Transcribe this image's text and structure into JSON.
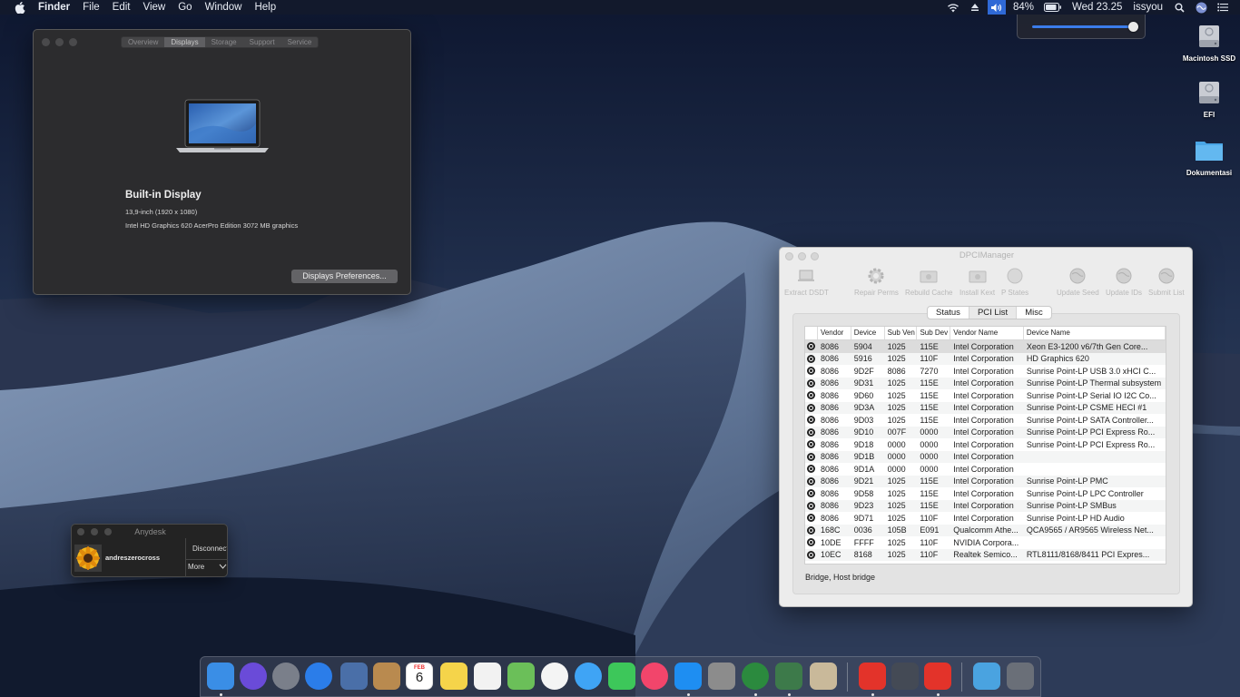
{
  "menubar": {
    "app_name": "Finder",
    "menus": [
      "File",
      "Edit",
      "View",
      "Go",
      "Window",
      "Help"
    ],
    "battery": "84%",
    "clock": "Wed 23.25",
    "user": "issyou",
    "volume_level": 0.9
  },
  "desktop_icons": [
    {
      "label": "Macintosh SSD",
      "icon": "hard-drive-icon"
    },
    {
      "label": "EFI",
      "icon": "hard-drive-icon"
    },
    {
      "label": "Dokumentasi",
      "icon": "folder-icon"
    }
  ],
  "about": {
    "tabs": [
      "Overview",
      "Displays",
      "Storage",
      "Support",
      "Service"
    ],
    "active_tab": "Displays",
    "display_title": "Built-in Display",
    "display_size": "13,9-inch (1920 x 1080)",
    "graphics": "Intel HD Graphics 620 AcerPro Edition 3072 MB graphics",
    "prefs_button": "Displays Preferences..."
  },
  "anydesk": {
    "title": "Anydesk",
    "user": "andreszerocross",
    "disconnect": "Disconnect",
    "more": "More"
  },
  "dpci": {
    "title": "DPCIManager",
    "toolbar": [
      "Extract DSDT",
      "Repair Perms",
      "Rebuild Cache",
      "Install Kext",
      "P States",
      "Update Seed",
      "Update IDs",
      "Submit List"
    ],
    "tabs": [
      "Status",
      "PCI List",
      "Misc"
    ],
    "active_tab": "PCI List",
    "columns": [
      "Vendor",
      "Device",
      "Sub Ven",
      "Sub Dev",
      "Vendor Name",
      "Device Name"
    ],
    "rows": [
      [
        "8086",
        "5904",
        "1025",
        "115E",
        "Intel Corporation",
        "Xeon E3-1200 v6/7th Gen Core..."
      ],
      [
        "8086",
        "5916",
        "1025",
        "110F",
        "Intel Corporation",
        "HD Graphics 620"
      ],
      [
        "8086",
        "9D2F",
        "8086",
        "7270",
        "Intel Corporation",
        "Sunrise Point-LP USB 3.0 xHCI C..."
      ],
      [
        "8086",
        "9D31",
        "1025",
        "115E",
        "Intel Corporation",
        "Sunrise Point-LP Thermal subsystem"
      ],
      [
        "8086",
        "9D60",
        "1025",
        "115E",
        "Intel Corporation",
        "Sunrise Point-LP Serial IO I2C Co..."
      ],
      [
        "8086",
        "9D3A",
        "1025",
        "115E",
        "Intel Corporation",
        "Sunrise Point-LP CSME HECI #1"
      ],
      [
        "8086",
        "9D03",
        "1025",
        "115E",
        "Intel Corporation",
        "Sunrise Point-LP SATA Controller..."
      ],
      [
        "8086",
        "9D10",
        "007F",
        "0000",
        "Intel Corporation",
        "Sunrise Point-LP PCI Express Ro..."
      ],
      [
        "8086",
        "9D18",
        "0000",
        "0000",
        "Intel Corporation",
        "Sunrise Point-LP PCI Express Ro..."
      ],
      [
        "8086",
        "9D1B",
        "0000",
        "0000",
        "Intel Corporation",
        ""
      ],
      [
        "8086",
        "9D1A",
        "0000",
        "0000",
        "Intel Corporation",
        ""
      ],
      [
        "8086",
        "9D21",
        "1025",
        "115E",
        "Intel Corporation",
        "Sunrise Point-LP PMC"
      ],
      [
        "8086",
        "9D58",
        "1025",
        "115E",
        "Intel Corporation",
        "Sunrise Point-LP LPC Controller"
      ],
      [
        "8086",
        "9D23",
        "1025",
        "115E",
        "Intel Corporation",
        "Sunrise Point-LP SMBus"
      ],
      [
        "8086",
        "9D71",
        "1025",
        "110F",
        "Intel Corporation",
        "Sunrise Point-LP HD Audio"
      ],
      [
        "168C",
        "0036",
        "105B",
        "E091",
        "Qualcomm Athe...",
        "QCA9565 / AR9565 Wireless Net..."
      ],
      [
        "10DE",
        "FFFF",
        "1025",
        "110F",
        "NVIDIA Corpora...",
        ""
      ],
      [
        "10EC",
        "8168",
        "1025",
        "110F",
        "Realtek Semico...",
        "RTL8111/8168/8411 PCI Expres..."
      ]
    ],
    "status": "Bridge, Host bridge"
  },
  "dock": {
    "calendar_month": "FEB",
    "calendar_day": "6",
    "apps": [
      {
        "name": "finder-icon",
        "color": "#3a8ee6"
      },
      {
        "name": "siri-icon",
        "color": "#6a4bd8"
      },
      {
        "name": "launchpad-icon",
        "color": "#7a7f8a"
      },
      {
        "name": "safari-icon",
        "color": "#2b7de9"
      },
      {
        "name": "preview-icon",
        "color": "#4a6fa8"
      },
      {
        "name": "contacts-icon",
        "color": "#b98a4f"
      },
      {
        "name": "calendar-icon",
        "color": "#ffffff"
      },
      {
        "name": "notes-icon",
        "color": "#f5d44a"
      },
      {
        "name": "reminders-icon",
        "color": "#f2f2f2"
      },
      {
        "name": "maps-icon",
        "color": "#6bbf59"
      },
      {
        "name": "photos-icon",
        "color": "#f4f4f4"
      },
      {
        "name": "messages-icon",
        "color": "#3fa4f5"
      },
      {
        "name": "facetime-icon",
        "color": "#3dc75a"
      },
      {
        "name": "itunes-icon",
        "color": "#f2456b"
      },
      {
        "name": "app-store-icon",
        "color": "#1e8ef2"
      },
      {
        "name": "system-preferences-icon",
        "color": "#8c8c8c"
      },
      {
        "name": "globe-icon",
        "color": "#2b8a3e"
      },
      {
        "name": "system-information-icon",
        "color": "#3d7a4a"
      },
      {
        "name": "script-editor-icon",
        "color": "#c9b99a"
      },
      {
        "name": "anydesk-icon",
        "color": "#e3332a"
      },
      {
        "name": "kext-utility-icon",
        "color": "#444a55"
      },
      {
        "name": "anydesk-alt-icon",
        "color": "#e3332a"
      },
      {
        "name": "downloads-folder-icon",
        "color": "#4aa3e0"
      },
      {
        "name": "trash-icon",
        "color": "#6a6f78"
      }
    ]
  }
}
